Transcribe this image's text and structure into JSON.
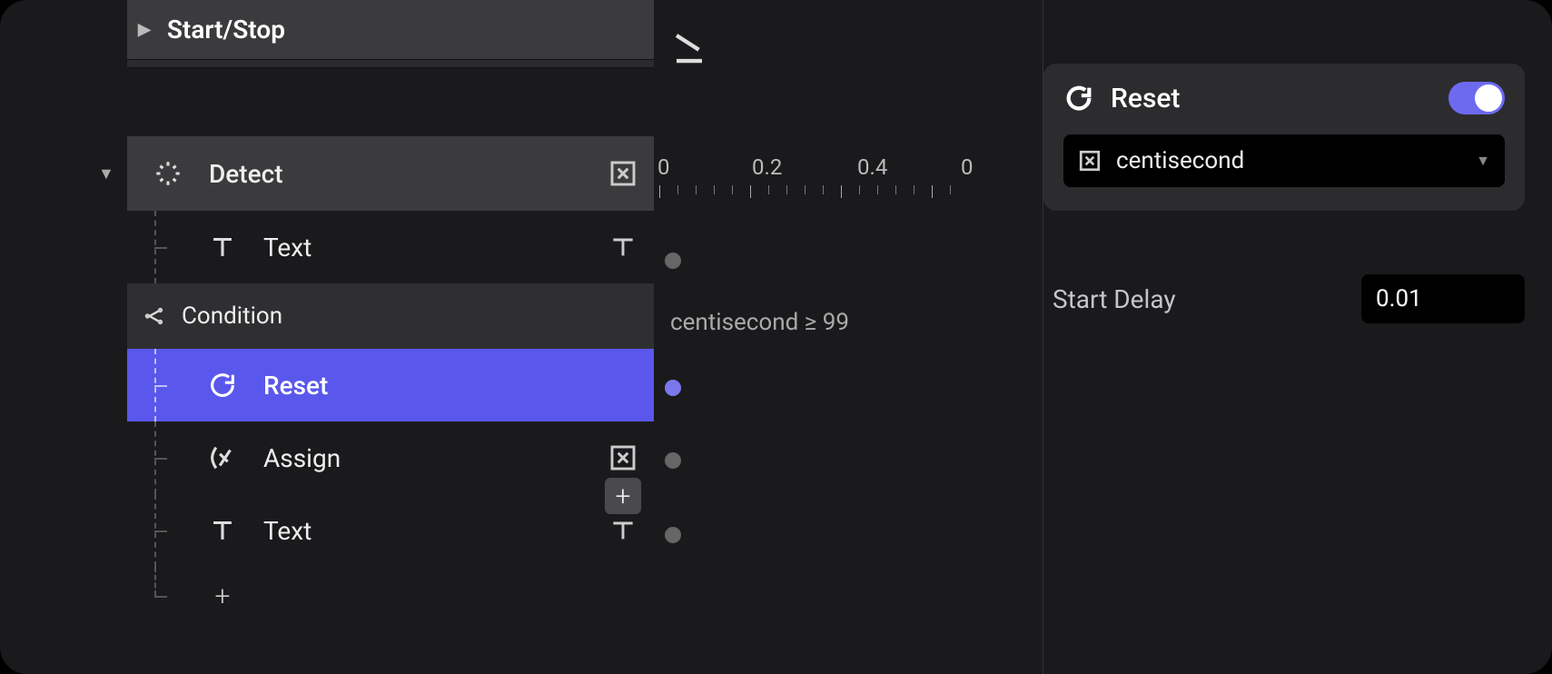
{
  "tree": {
    "header": "Start/Stop",
    "detect": "Detect",
    "items": {
      "text1": "Text",
      "condition": "Condition",
      "reset": "Reset",
      "assign": "Assign",
      "text2": "Text"
    }
  },
  "timeline": {
    "ticks": [
      "0",
      "0.2",
      "0.4",
      "0"
    ],
    "condition_label": "centisecond ≥ 99"
  },
  "inspector": {
    "title": "Reset",
    "toggle_on": true,
    "target": "centisecond",
    "start_delay_label": "Start Delay",
    "start_delay_value": "0.01"
  }
}
